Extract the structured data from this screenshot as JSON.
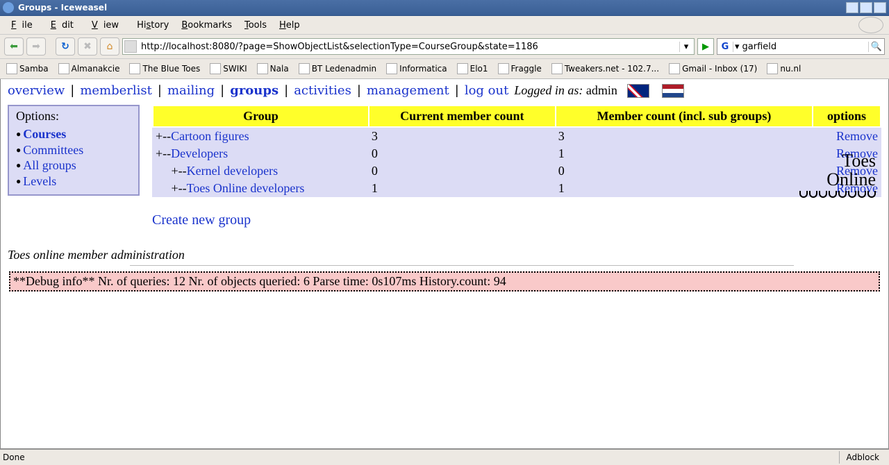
{
  "window": {
    "title": "Groups - Iceweasel"
  },
  "menubar": [
    "File",
    "Edit",
    "View",
    "History",
    "Bookmarks",
    "Tools",
    "Help"
  ],
  "toolbar": {
    "url": "http://localhost:8080/?page=ShowObjectList&selectionType=CourseGroup&state=1186",
    "search_engine_glyph": "G",
    "search_value": "garfield"
  },
  "bookmarks": [
    "Samba",
    "Almanakcie",
    "The Blue Toes",
    "SWIKI",
    "Nala",
    "BT Ledenadmin",
    "Informatica",
    "Elo1",
    "Fraggle",
    "Tweakers.net - 102.7...",
    "Gmail - Inbox (17)",
    "nu.nl"
  ],
  "nav": {
    "items": [
      "overview",
      "memberlist",
      "mailing",
      "groups",
      "activities",
      "management",
      "log out"
    ],
    "active_index": 3,
    "logged_in_label": "Logged in as:",
    "user": "admin"
  },
  "brand": {
    "line1": "Toes",
    "line2": "Online"
  },
  "options": {
    "heading": "Options:",
    "items": [
      "Courses",
      "Committees",
      "All groups",
      "Levels"
    ],
    "active_index": 0
  },
  "table": {
    "headers": [
      "Group",
      "Current member count",
      "Member count (incl. sub groups)",
      "options"
    ],
    "rows": [
      {
        "indent": 0,
        "prefix": "+--",
        "name": "Cartoon figures",
        "current": "3",
        "incl": "3",
        "opt": "Remove"
      },
      {
        "indent": 0,
        "prefix": "+--",
        "name": "Developers",
        "current": "0",
        "incl": "1",
        "opt": "Remove"
      },
      {
        "indent": 1,
        "prefix": "+--",
        "name": "Kernel developers",
        "current": "0",
        "incl": "0",
        "opt": "Remove"
      },
      {
        "indent": 1,
        "prefix": "+--",
        "name": "Toes Online developers",
        "current": "1",
        "incl": "1",
        "opt": "Remove"
      }
    ],
    "create_label": "Create new group"
  },
  "footer": {
    "tagline": "Toes online member administration",
    "debug": "**Debug info** Nr. of queries: 12 Nr. of objects queried: 6 Parse time: 0s107ms History.count: 94"
  },
  "status": {
    "left": "Done",
    "right": "Adblock"
  }
}
